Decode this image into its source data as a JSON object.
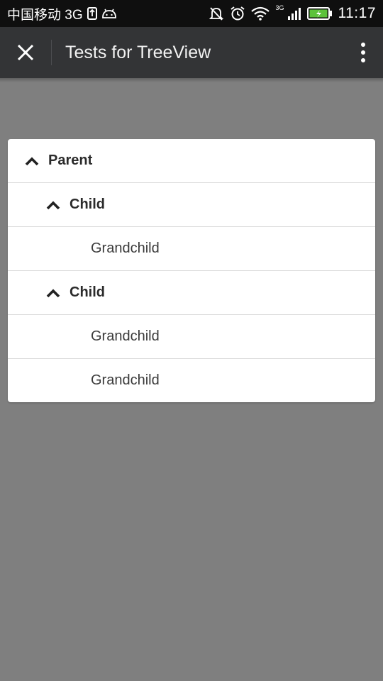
{
  "status_bar": {
    "carrier": "中国移动 3G",
    "network_small": "3G",
    "time": "11:17",
    "icons": [
      "usb-icon",
      "android-debug-icon",
      "mute-icon",
      "alarm-icon",
      "wifi-icon",
      "signal-icon",
      "battery-icon"
    ]
  },
  "app_bar": {
    "title": "Tests for TreeView",
    "close_icon": "close-icon",
    "more_icon": "more-vert-icon"
  },
  "tree": {
    "nodes": [
      {
        "label": "Parent",
        "level": 0,
        "expanded": true
      },
      {
        "label": "Child",
        "level": 1,
        "expanded": true
      },
      {
        "label": "Grandchild",
        "level": 2
      },
      {
        "label": "Child",
        "level": 1,
        "expanded": true
      },
      {
        "label": "Grandchild",
        "level": 2
      },
      {
        "label": "Grandchild",
        "level": 2
      }
    ]
  },
  "colors": {
    "status_bar": "#0f0f0f",
    "app_bar": "#333436",
    "background": "#7f7f7f",
    "card": "#ffffff"
  }
}
